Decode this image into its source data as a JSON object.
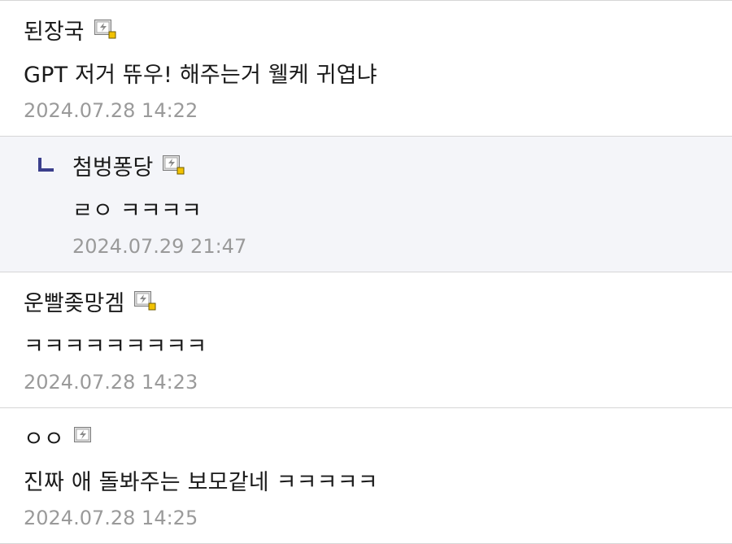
{
  "comments": [
    {
      "author": "된장국",
      "body": "GPT 저거 뜌우! 해주는거 웰케 귀엽냐",
      "date": "2024.07.28 14:22",
      "is_reply": false,
      "icon": "gallog-icon-fixed"
    },
    {
      "author": "첨벙퐁당",
      "body": "ㄹㅇ ㅋㅋㅋㅋ",
      "date": "2024.07.29 21:47",
      "is_reply": true,
      "icon": "gallog-icon-fixed"
    },
    {
      "author": "운빨좆망겜",
      "body": "ㅋㅋㅋㅋㅋㅋㅋㅋㅋ",
      "date": "2024.07.28 14:23",
      "is_reply": false,
      "icon": "gallog-icon-fixed"
    },
    {
      "author": "ㅇㅇ",
      "body": "진짜 애 돌봐주는 보모같네 ㅋㅋㅋㅋㅋ",
      "date": "2024.07.28 14:25",
      "is_reply": false,
      "icon": "gallog-icon-semi"
    }
  ],
  "colors": {
    "reply_background": "#f4f5f9",
    "date_text": "#9a9a9a",
    "divider": "#d6d6d6",
    "reply_arrow": "#3b3f8c",
    "icon_badge": "#f2c200"
  }
}
